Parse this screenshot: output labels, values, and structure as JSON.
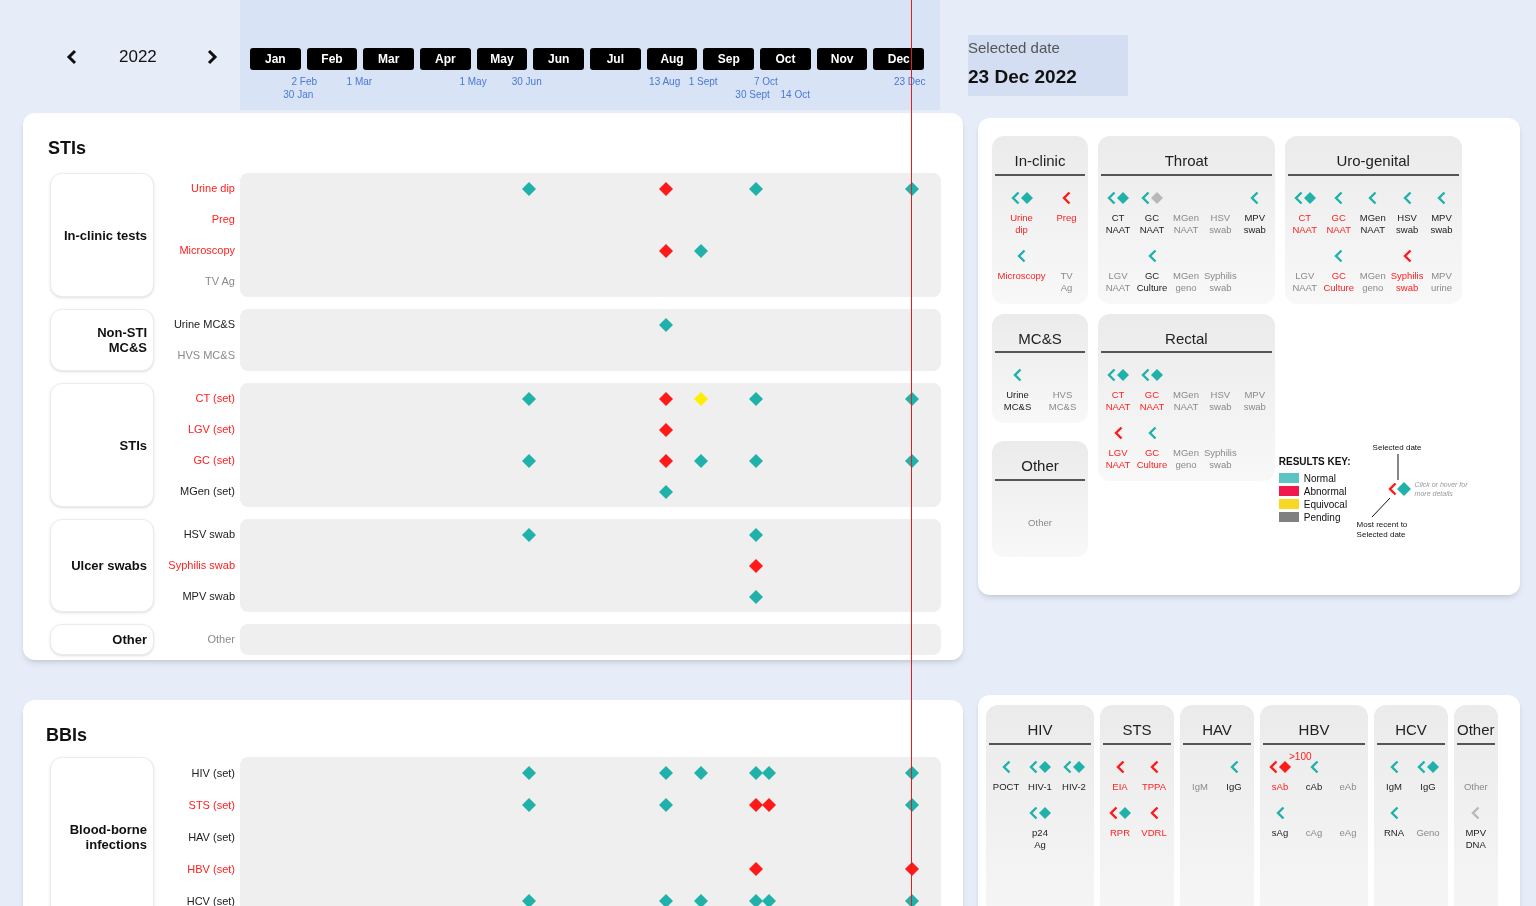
{
  "header": {
    "year": "2022",
    "months": [
      "Jan",
      "Feb",
      "Mar",
      "Apr",
      "May",
      "Jun",
      "Jul",
      "Aug",
      "Sep",
      "Oct",
      "Nov",
      "Dec"
    ],
    "dates": [
      {
        "label": "2 Feb",
        "level": 0.086
      },
      {
        "label": "1 Mar",
        "level": 0.167
      },
      {
        "label": "1 May",
        "level": 0.333
      },
      {
        "label": "30 Jun",
        "level": 0.414
      },
      {
        "label": "13 Aug",
        "level": 0.616
      },
      {
        "label": "1 Sept",
        "level": 0.667
      },
      {
        "label": "7 Oct",
        "level": 0.766
      },
      {
        "label": "23 Dec",
        "level": 0.976
      },
      {
        "label": "30 Jan",
        "level": 0.078
      },
      {
        "label": "30 Sept",
        "level": 0.747
      },
      {
        "label": "14 Oct",
        "level": 0.785
      }
    ]
  },
  "selected_date": {
    "caption": "Selected date",
    "value": "23 Dec 2022",
    "level": 0.976
  },
  "sti": {
    "title": "STIs",
    "groups": [
      {
        "label": "In-clinic tests",
        "rows": [
          {
            "label": "Urine dip",
            "abnormal": true,
            "disabled": false,
            "markers": [
              {
                "level": 0.414,
                "color": "#20b2aa"
              },
              {
                "level": 0.616,
                "color": "#ff1a1a"
              },
              {
                "level": 0.747,
                "color": "#20b2aa"
              },
              {
                "level": 0.976,
                "color": "#20b2aa"
              }
            ]
          },
          {
            "label": "Preg",
            "abnormal": true,
            "disabled": false
          },
          {
            "label": "Microscopy",
            "abnormal": true,
            "disabled": false,
            "markers": [
              {
                "level": 0.616,
                "color": "#ff1a1a"
              },
              {
                "level": 0.667,
                "color": "#20b2aa"
              }
            ]
          },
          {
            "label": "TV Ag",
            "abnormal": false,
            "disabled": true
          }
        ]
      },
      {
        "label": "Non-STI MC&S",
        "rows": [
          {
            "label": "Urine MC&S",
            "abnormal": false,
            "disabled": false,
            "markers": [
              {
                "level": 0.616,
                "color": "#20b2aa"
              }
            ]
          },
          {
            "label": "HVS MC&S",
            "abnormal": false,
            "disabled": true
          }
        ]
      },
      {
        "label": "STIs",
        "rows": [
          {
            "label": "CT (set)",
            "abnormal": true,
            "disabled": false,
            "markers": [
              {
                "level": 0.414,
                "color": "#20b2aa"
              },
              {
                "level": 0.616,
                "color": "#ff1a1a"
              },
              {
                "level": 0.667,
                "color": "#ffee00"
              },
              {
                "level": 0.747,
                "color": "#20b2aa"
              },
              {
                "level": 0.976,
                "color": "#20b2aa"
              }
            ]
          },
          {
            "label": "LGV (set)",
            "abnormal": true,
            "disabled": false,
            "markers": [
              {
                "level": 0.616,
                "color": "#ff1a1a"
              }
            ]
          },
          {
            "label": "GC (set)",
            "abnormal": true,
            "disabled": false,
            "markers": [
              {
                "level": 0.414,
                "color": "#20b2aa"
              },
              {
                "level": 0.616,
                "color": "#ff1a1a"
              },
              {
                "level": 0.667,
                "color": "#20b2aa"
              },
              {
                "level": 0.747,
                "color": "#20b2aa"
              },
              {
                "level": 0.976,
                "color": "#20b2aa"
              }
            ]
          },
          {
            "label": "MGen (set)",
            "abnormal": false,
            "disabled": false,
            "markers": [
              {
                "level": 0.616,
                "color": "#20b2aa"
              }
            ]
          }
        ]
      },
      {
        "label": "Ulcer swabs",
        "rows": [
          {
            "label": "HSV swab",
            "abnormal": false,
            "disabled": false,
            "markers": [
              {
                "level": 0.414,
                "color": "#20b2aa"
              },
              {
                "level": 0.747,
                "color": "#20b2aa"
              }
            ]
          },
          {
            "label": "Syphilis swab",
            "abnormal": true,
            "disabled": false,
            "markers": [
              {
                "level": 0.747,
                "color": "#ff1a1a"
              }
            ]
          },
          {
            "label": "MPV swab",
            "abnormal": false,
            "disabled": false,
            "markers": [
              {
                "level": 0.747,
                "color": "#20b2aa"
              }
            ]
          }
        ]
      },
      {
        "label": "Other",
        "rows": [
          {
            "label": "Other",
            "abnormal": false,
            "disabled": true
          }
        ]
      }
    ]
  },
  "bbi": {
    "title": "BBIs",
    "groups": [
      {
        "label": "Blood-borne infections",
        "rows": [
          {
            "label": "HIV (set)",
            "abnormal": false,
            "disabled": false,
            "markers": [
              {
                "level": 0.414,
                "color": "#20b2aa"
              },
              {
                "level": 0.616,
                "color": "#20b2aa"
              },
              {
                "level": 0.667,
                "color": "#20b2aa"
              },
              {
                "level": 0.747,
                "color": "#20b2aa"
              },
              {
                "level": 0.766,
                "color": "#20b2aa"
              },
              {
                "level": 0.976,
                "color": "#20b2aa"
              }
            ]
          },
          {
            "label": "STS (set)",
            "abnormal": true,
            "disabled": false,
            "markers": [
              {
                "level": 0.414,
                "color": "#20b2aa"
              },
              {
                "level": 0.616,
                "color": "#20b2aa"
              },
              {
                "level": 0.747,
                "color": "#ff1a1a"
              },
              {
                "level": 0.766,
                "color": "#ff1a1a"
              },
              {
                "level": 0.976,
                "color": "#20b2aa"
              }
            ]
          },
          {
            "label": "HAV (set)",
            "abnormal": false,
            "disabled": false
          },
          {
            "label": "HBV (set)",
            "abnormal": true,
            "disabled": false,
            "markers": [
              {
                "level": 0.747,
                "color": "#ff1a1a"
              },
              {
                "level": 0.976,
                "color": "#ff1a1a"
              }
            ]
          },
          {
            "label": "HCV (set)",
            "abnormal": false,
            "disabled": false,
            "markers": [
              {
                "level": 0.414,
                "color": "#20b2aa"
              },
              {
                "level": 0.616,
                "color": "#20b2aa"
              },
              {
                "level": 0.667,
                "color": "#20b2aa"
              },
              {
                "level": 0.747,
                "color": "#20b2aa"
              },
              {
                "level": 0.766,
                "color": "#20b2aa"
              },
              {
                "level": 0.976,
                "color": "#20b2aa"
              }
            ]
          }
        ]
      }
    ]
  },
  "sti_sites": {
    "cards": [
      {
        "title": "In-clinic",
        "rows": [
          [
            {
              "label": "Urine\ndip",
              "abnormal": true,
              "disabled": false,
              "recent": {
                "color": "#20b2aa"
              },
              "on_date": {
                "color": "#20b2aa"
              }
            },
            {
              "label": "Preg",
              "abnormal": true,
              "disabled": false,
              "recent": {
                "color": "#ff1a1a"
              }
            }
          ],
          [
            {
              "label": "Microscopy",
              "abnormal": true,
              "disabled": false,
              "recent": {
                "color": "#20b2aa"
              }
            },
            {
              "label": "TV\nAg",
              "abnormal": false,
              "disabled": true
            }
          ]
        ]
      },
      {
        "title": "Throat",
        "rows": [
          [
            {
              "label": "CT\nNAAT",
              "abnormal": false,
              "disabled": false,
              "recent": {
                "color": "#20b2aa"
              },
              "on_date": {
                "color": "#20b2aa"
              }
            },
            {
              "label": "GC\nNAAT",
              "abnormal": false,
              "disabled": false,
              "recent": {
                "color": "#20b2aa"
              },
              "on_date": {
                "color": "#b8b8b8"
              }
            },
            {
              "label": "MGen\nNAAT",
              "abnormal": false,
              "disabled": true
            },
            {
              "label": "HSV\nswab",
              "abnormal": false,
              "disabled": true
            },
            {
              "label": "MPV\nswab",
              "abnormal": false,
              "disabled": false,
              "recent": {
                "color": "#20b2aa"
              }
            }
          ],
          [
            {
              "label": "LGV\nNAAT",
              "abnormal": false,
              "disabled": true
            },
            {
              "label": "GC\nCulture",
              "abnormal": false,
              "disabled": false,
              "recent": {
                "color": "#20b2aa"
              }
            },
            {
              "label": "MGen\ngeno",
              "abnormal": false,
              "disabled": true
            },
            {
              "label": "Syphilis\nswab",
              "abnormal": false,
              "disabled": true
            }
          ]
        ]
      },
      {
        "title": "Uro-genital",
        "rows": [
          [
            {
              "label": "CT\nNAAT",
              "abnormal": true,
              "disabled": false,
              "recent": {
                "color": "#20b2aa"
              },
              "on_date": {
                "color": "#20b2aa"
              }
            },
            {
              "label": "GC\nNAAT",
              "abnormal": true,
              "disabled": false,
              "recent": {
                "color": "#20b2aa"
              }
            },
            {
              "label": "MGen\nNAAT",
              "abnormal": false,
              "disabled": false,
              "recent": {
                "color": "#20b2aa"
              }
            },
            {
              "label": "HSV\nswab",
              "abnormal": false,
              "disabled": false,
              "recent": {
                "color": "#20b2aa"
              }
            },
            {
              "label": "MPV\nswab",
              "abnormal": false,
              "disabled": false,
              "recent": {
                "color": "#20b2aa"
              }
            }
          ],
          [
            {
              "label": "LGV\nNAAT",
              "abnormal": false,
              "disabled": true
            },
            {
              "label": "GC\nCulture",
              "abnormal": true,
              "disabled": false,
              "recent": {
                "color": "#20b2aa"
              }
            },
            {
              "label": "MGen\ngeno",
              "abnormal": false,
              "disabled": true
            },
            {
              "label": "Syphilis\nswab",
              "abnormal": true,
              "disabled": false,
              "recent": {
                "color": "#ff1a1a"
              }
            },
            {
              "label": "MPV\nurine",
              "abnormal": false,
              "disabled": true
            }
          ]
        ]
      },
      {
        "title": "MC&S",
        "rows": [
          [
            {
              "label": "Urine\nMC&S",
              "abnormal": false,
              "disabled": false,
              "recent": {
                "color": "#20b2aa"
              }
            },
            {
              "label": "HVS\nMC&S",
              "abnormal": false,
              "disabled": true
            }
          ]
        ]
      },
      {
        "title": "Rectal",
        "rows": [
          [
            {
              "label": "CT\nNAAT",
              "abnormal": true,
              "disabled": false,
              "recent": {
                "color": "#20b2aa"
              },
              "on_date": {
                "color": "#20b2aa"
              }
            },
            {
              "label": "GC\nNAAT",
              "abnormal": true,
              "disabled": false,
              "recent": {
                "color": "#20b2aa"
              },
              "on_date": {
                "color": "#20b2aa"
              }
            },
            {
              "label": "MGen\nNAAT",
              "abnormal": false,
              "disabled": true
            },
            {
              "label": "HSV\nswab",
              "abnormal": false,
              "disabled": true
            },
            {
              "label": "MPV\nswab",
              "abnormal": false,
              "disabled": true
            }
          ],
          [
            {
              "label": "LGV\nNAAT",
              "abnormal": true,
              "disabled": false,
              "recent": {
                "color": "#ff1a1a"
              }
            },
            {
              "label": "GC\nCulture",
              "abnormal": true,
              "disabled": false,
              "recent": {
                "color": "#20b2aa"
              }
            },
            {
              "label": "MGen\ngeno",
              "abnormal": false,
              "disabled": true
            },
            {
              "label": "Syphilis\nswab",
              "abnormal": false,
              "disabled": true
            }
          ]
        ]
      },
      {
        "title": "Other",
        "rows": [
          [
            {
              "label": "Other",
              "abnormal": false,
              "disabled": true
            }
          ]
        ]
      }
    ]
  },
  "results_key": {
    "title": "RESULTS KEY:",
    "items": [
      {
        "label": "Normal",
        "color": "#5cc4c2"
      },
      {
        "label": "Abnormal",
        "color": "#f0184c"
      },
      {
        "label": "Equivocal",
        "color": "#f8d624"
      },
      {
        "label": "Pending",
        "color": "#808080"
      }
    ],
    "diagram": {
      "top": "Selected date",
      "hint": "Click or hover for more details",
      "bottom": "Most recent to Selected date",
      "recent": {
        "color": "#ff1a1a"
      },
      "on_date": {
        "color": "#20b2aa"
      }
    }
  },
  "bbi_sites": {
    "cards": [
      {
        "title": "HIV",
        "rows": [
          [
            {
              "label": "POCT",
              "abnormal": false,
              "disabled": false,
              "recent": {
                "color": "#20b2aa"
              }
            },
            {
              "label": "HIV-1",
              "abnormal": false,
              "disabled": false,
              "recent": {
                "color": "#20b2aa"
              },
              "on_date": {
                "color": "#20b2aa"
              }
            },
            {
              "label": "HIV-2",
              "abnormal": false,
              "disabled": false,
              "recent": {
                "color": "#20b2aa"
              },
              "on_date": {
                "color": "#20b2aa"
              }
            }
          ],
          [
            "",
            {
              "label": "p24\nAg",
              "abnormal": false,
              "disabled": false,
              "recent": {
                "color": "#20b2aa"
              },
              "on_date": {
                "color": "#20b2aa"
              }
            }
          ]
        ]
      },
      {
        "title": "STS",
        "rows": [
          [
            {
              "label": "EIA",
              "abnormal": true,
              "disabled": false,
              "recent": {
                "color": "#ff1a1a"
              }
            },
            {
              "label": "TPPA",
              "abnormal": true,
              "disabled": false,
              "recent": {
                "color": "#ff1a1a"
              }
            }
          ],
          [
            {
              "label": "RPR",
              "abnormal": true,
              "disabled": false,
              "recent": {
                "color": "#ff1a1a"
              },
              "on_date": {
                "color": "#20b2aa"
              }
            },
            {
              "label": "VDRL",
              "abnormal": true,
              "disabled": false,
              "recent": {
                "color": "#ff1a1a"
              }
            }
          ]
        ]
      },
      {
        "title": "HAV",
        "rows": [
          [
            {
              "label": "IgM",
              "abnormal": false,
              "disabled": true
            },
            {
              "label": "IgG",
              "abnormal": false,
              "disabled": false,
              "recent": {
                "color": "#20b2aa"
              }
            }
          ]
        ]
      },
      {
        "title": "HBV",
        "rows": [
          [
            {
              "label": "sAb",
              "abnormal": true,
              "disabled": false,
              "recent": {
                "color": "#ff1a1a"
              },
              "on_date": {
                "color": "#ff1a1a"
              },
              "note": ">100"
            },
            {
              "label": "cAb",
              "abnormal": false,
              "disabled": false,
              "recent": {
                "color": "#20b2aa"
              }
            },
            {
              "label": "eAb",
              "abnormal": false,
              "disabled": true
            }
          ],
          [
            {
              "label": "sAg",
              "abnormal": false,
              "disabled": false,
              "recent": {
                "color": "#20b2aa"
              }
            },
            {
              "label": "cAg",
              "abnormal": false,
              "disabled": true
            },
            {
              "label": "eAg",
              "abnormal": false,
              "disabled": true
            }
          ]
        ]
      },
      {
        "title": "HCV",
        "rows": [
          [
            {
              "label": "IgM",
              "abnormal": false,
              "disabled": false,
              "recent": {
                "color": "#20b2aa"
              }
            },
            {
              "label": "IgG",
              "abnormal": false,
              "disabled": false,
              "recent": {
                "color": "#20b2aa"
              },
              "on_date": {
                "color": "#20b2aa"
              }
            }
          ],
          [
            {
              "label": "RNA",
              "abnormal": false,
              "disabled": false,
              "recent": {
                "color": "#20b2aa"
              }
            },
            {
              "label": "Geno",
              "abnormal": false,
              "disabled": true
            }
          ]
        ]
      },
      {
        "title": "Other",
        "rows": [
          [
            {
              "label": "Other",
              "abnormal": false,
              "disabled": true
            }
          ],
          [
            {
              "label": "MPV\nDNA",
              "abnormal": false,
              "disabled": false,
              "recent": {
                "color": "#b8b8b8"
              }
            }
          ]
        ]
      }
    ]
  }
}
